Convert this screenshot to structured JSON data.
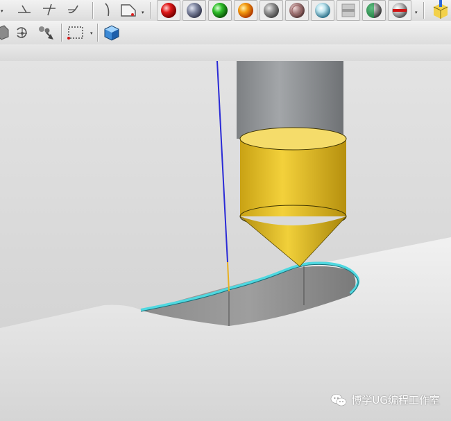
{
  "toolbar_top": {
    "groups": [
      {
        "name": "curve-tools",
        "icons": [
          "line-icon",
          "tangent-line-icon",
          "arc-curve-icon"
        ]
      },
      {
        "name": "sketch-tools",
        "icons": [
          "sketch-curve-icon",
          "sketch-plane-icon"
        ]
      },
      {
        "name": "materials",
        "icons": [
          "red-sphere-icon",
          "gray-blue-sphere-icon",
          "green-sphere-icon",
          "orange-sphere-icon",
          "gray-sphere-icon",
          "rose-sphere-icon",
          "chrome-sphere-icon",
          "section-cut-icon",
          "split-sphere-icon",
          "edge-sphere-icon"
        ]
      },
      {
        "name": "view",
        "icons": [
          "color-cube-icon"
        ]
      }
    ]
  },
  "toolbar_second": {
    "icons": [
      "partial-solid-icon",
      "rotate-snap-icon",
      "move-handle-icon",
      "selection-box-icon",
      "shaded-cube-icon"
    ]
  },
  "scene": {
    "description_colors": {
      "background": "#d9d9d9",
      "surface": "#e6e6e6",
      "tool_holder": "#8f9295",
      "tool_tip": "#f0cc2e",
      "toolpath": "#4fd8e0",
      "tool_axis": "#2a2ad6"
    }
  },
  "watermark": {
    "text": "博学UG编程工作室"
  }
}
